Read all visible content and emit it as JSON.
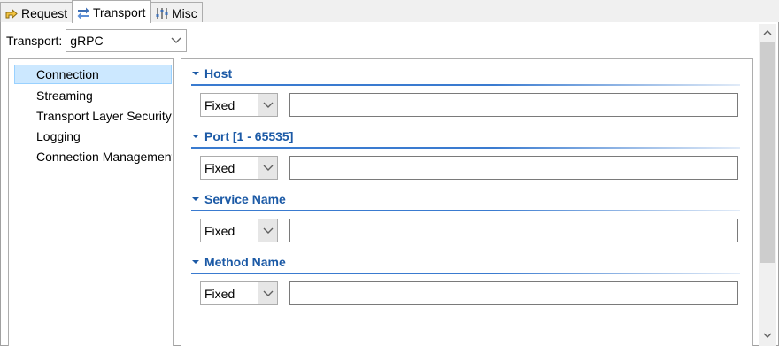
{
  "tabs": [
    {
      "label": "Request",
      "icon": "request-arrow-icon",
      "active": false
    },
    {
      "label": "Transport",
      "icon": "transport-arrows-icon",
      "active": true
    },
    {
      "label": "Misc",
      "icon": "misc-sliders-icon",
      "active": false
    }
  ],
  "transport": {
    "label": "Transport:",
    "selected": "gRPC"
  },
  "nav": {
    "items": [
      "Connection",
      "Streaming",
      "Transport Layer Security",
      "Logging",
      "Connection Management"
    ],
    "selected_index": 0
  },
  "sections": [
    {
      "title": "Host",
      "mode": "Fixed",
      "value": ""
    },
    {
      "title": "Port [1 - 65535]",
      "mode": "Fixed",
      "value": ""
    },
    {
      "title": "Service Name",
      "mode": "Fixed",
      "value": ""
    },
    {
      "title": "Method Name",
      "mode": "Fixed",
      "value": ""
    }
  ],
  "colors": {
    "section_title": "#1c5aa6",
    "selection": "#cce8ff"
  }
}
